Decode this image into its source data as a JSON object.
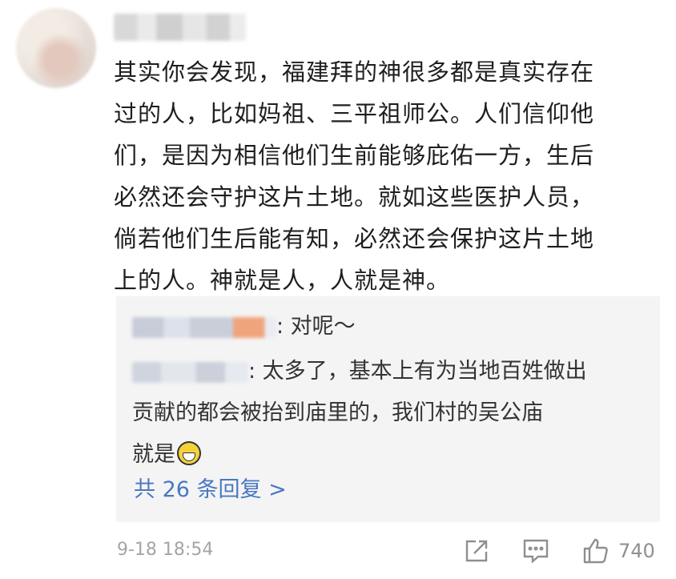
{
  "comment": {
    "lines": [
      "其实你会发现，福建拜的神很多都是真实存在",
      "过的人，比如妈祖、三平祖师公。人们信仰他",
      "们，是因为相信他们生前能够庇佑一方，生后",
      "必然还会守护这片土地。就如这些医护人员，",
      "倘若他们生后能有知，必然还会保护这片土地",
      "上的人。神就是人，人就是神。"
    ],
    "time": "9-18 18:54",
    "like_count": "740"
  },
  "replies": [
    {
      "text_lines": [
        ": 对呢～"
      ]
    },
    {
      "text_lines": [
        ": 太多了，基本上有为当地百姓做出",
        "贡献的都会被抬到庙里的，我们村的吴公庙",
        "就是"
      ],
      "emoji": "grinning-emoji"
    }
  ],
  "more_replies_label": "共 26 条回复 >",
  "icons": {
    "share": "share-icon",
    "comment": "comment-icon",
    "like": "thumbs-up-icon"
  },
  "colors": {
    "link": "#4a78c2",
    "meta": "#a5a5a5",
    "reply_bg": "#f4f4f4"
  }
}
